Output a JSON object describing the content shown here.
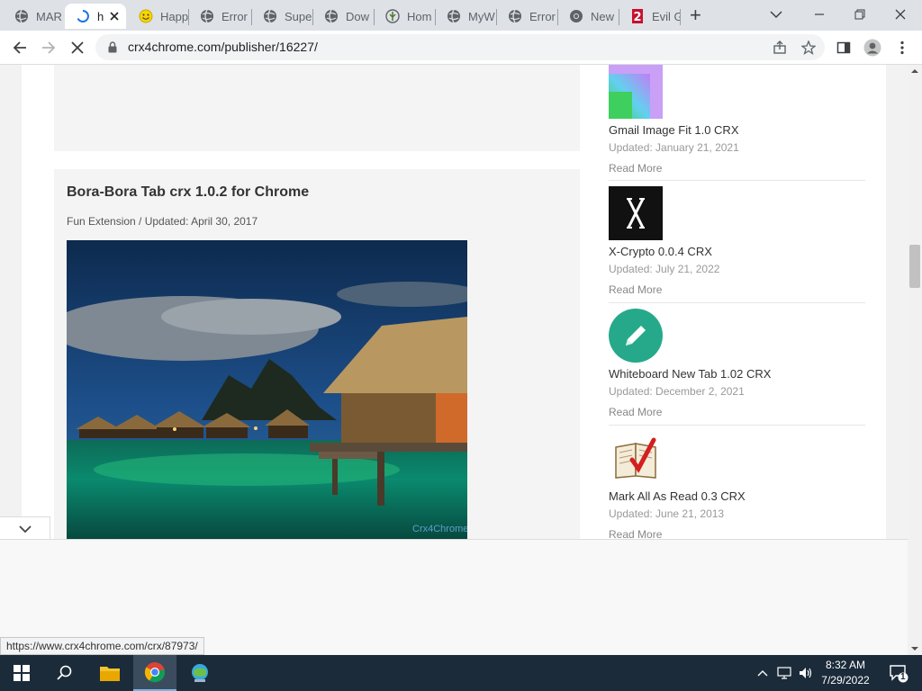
{
  "browser": {
    "tabs": [
      {
        "label": "MAR",
        "icon": "globe-icon"
      },
      {
        "label": "h",
        "icon": "loading-spinner-icon",
        "active": true
      },
      {
        "label": "Happ",
        "icon": "smiley-icon"
      },
      {
        "label": "Error",
        "icon": "globe-icon"
      },
      {
        "label": "Supe",
        "icon": "globe-icon"
      },
      {
        "label": "Dow",
        "icon": "globe-icon"
      },
      {
        "label": "Hom",
        "icon": "leaf-icon"
      },
      {
        "label": "MyW",
        "icon": "globe-icon"
      },
      {
        "label": "Error",
        "icon": "globe-icon"
      },
      {
        "label": "New",
        "icon": "chrome-icon"
      },
      {
        "label": "Evil G",
        "icon": "number-2-icon"
      }
    ],
    "new_tab": "+",
    "url": "crx4chrome.com/publisher/16227/",
    "status_url": "https://www.crx4chrome.com/crx/87973/"
  },
  "article": {
    "title": "Bora-Bora Tab crx 1.0.2 for Chrome",
    "meta": "Fun Extension / Updated: April 30, 2017",
    "image_watermark": "Crx4Chrome"
  },
  "sidebar": {
    "read_more": "Read More",
    "items": [
      {
        "title": "Gmail Image Fit 1.0 CRX",
        "updated": "Updated: January 21, 2021",
        "icon": "gradient-square-icon"
      },
      {
        "title": "X-Crypto 0.0.4 CRX",
        "updated": "Updated: July 21, 2022",
        "icon": "x-crypto-icon"
      },
      {
        "title": "Whiteboard New Tab 1.02 CRX",
        "updated": "Updated: December 2, 2021",
        "icon": "pencil-icon"
      },
      {
        "title": "Mark All As Read 0.3 CRX",
        "updated": "Updated: June 21, 2013",
        "icon": "book-checkmark-icon"
      }
    ]
  },
  "taskbar": {
    "time": "8:32 AM",
    "date": "7/29/2022",
    "notification_count": "1"
  },
  "colors": {
    "tabstrip": "#dee1e6",
    "taskbar": "#1b2b3a",
    "whiteboard_green": "#26a98b"
  }
}
